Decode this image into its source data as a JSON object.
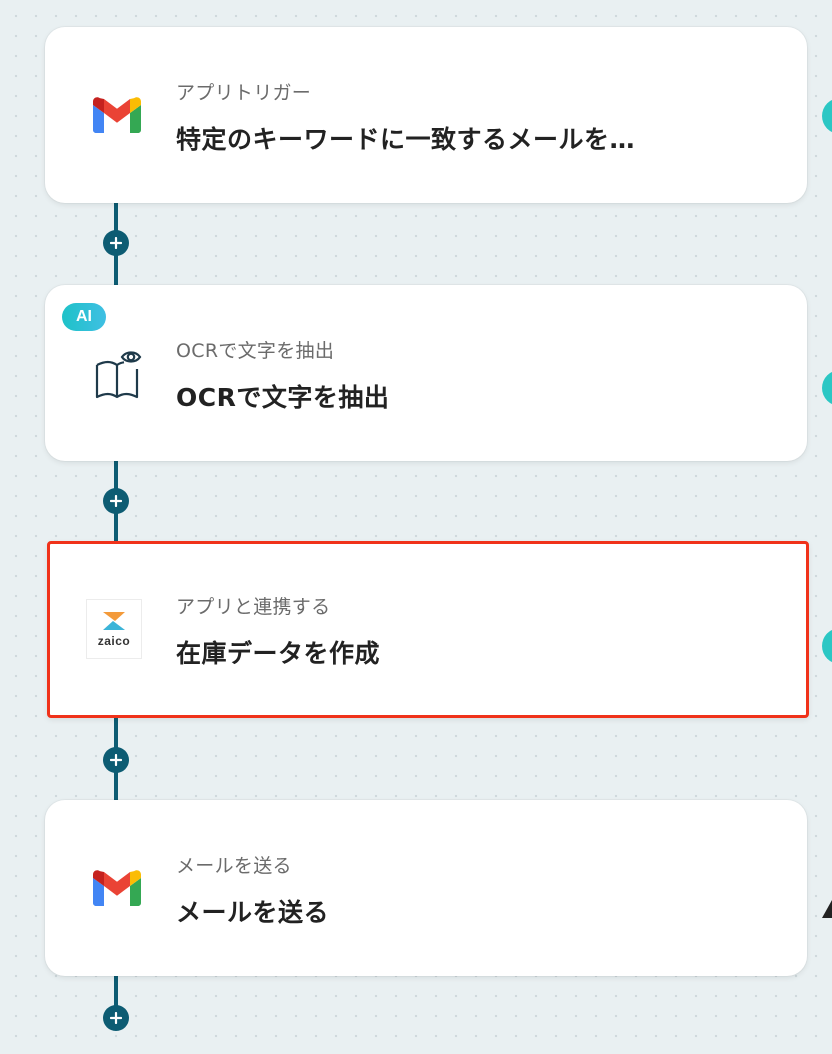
{
  "flow": {
    "steps": [
      {
        "app": "Gmail",
        "icon": "gmail-icon",
        "subtitle": "アプリトリガー",
        "title": "特定のキーワードに一致するメールを…"
      },
      {
        "app": "OCR",
        "icon": "ocr-book-eye-icon",
        "badge": "AI",
        "subtitle": "OCRで文字を抽出",
        "title": "OCRで文字を抽出"
      },
      {
        "app": "zaico",
        "icon": "zaico-logo",
        "logo_text": "zaico",
        "subtitle": "アプリと連携する",
        "title": "在庫データを作成",
        "selected": true
      },
      {
        "app": "Gmail",
        "icon": "gmail-icon",
        "subtitle": "メールを送る",
        "title": "メールを送る"
      }
    ],
    "add_step_icon": "plus-icon"
  },
  "colors": {
    "background": "#e9f0f2",
    "connector": "#0d5c73",
    "selected_border": "#f0321a",
    "ai_badge": "#1ec2c8",
    "edge_accent": "#2bc7c4"
  }
}
